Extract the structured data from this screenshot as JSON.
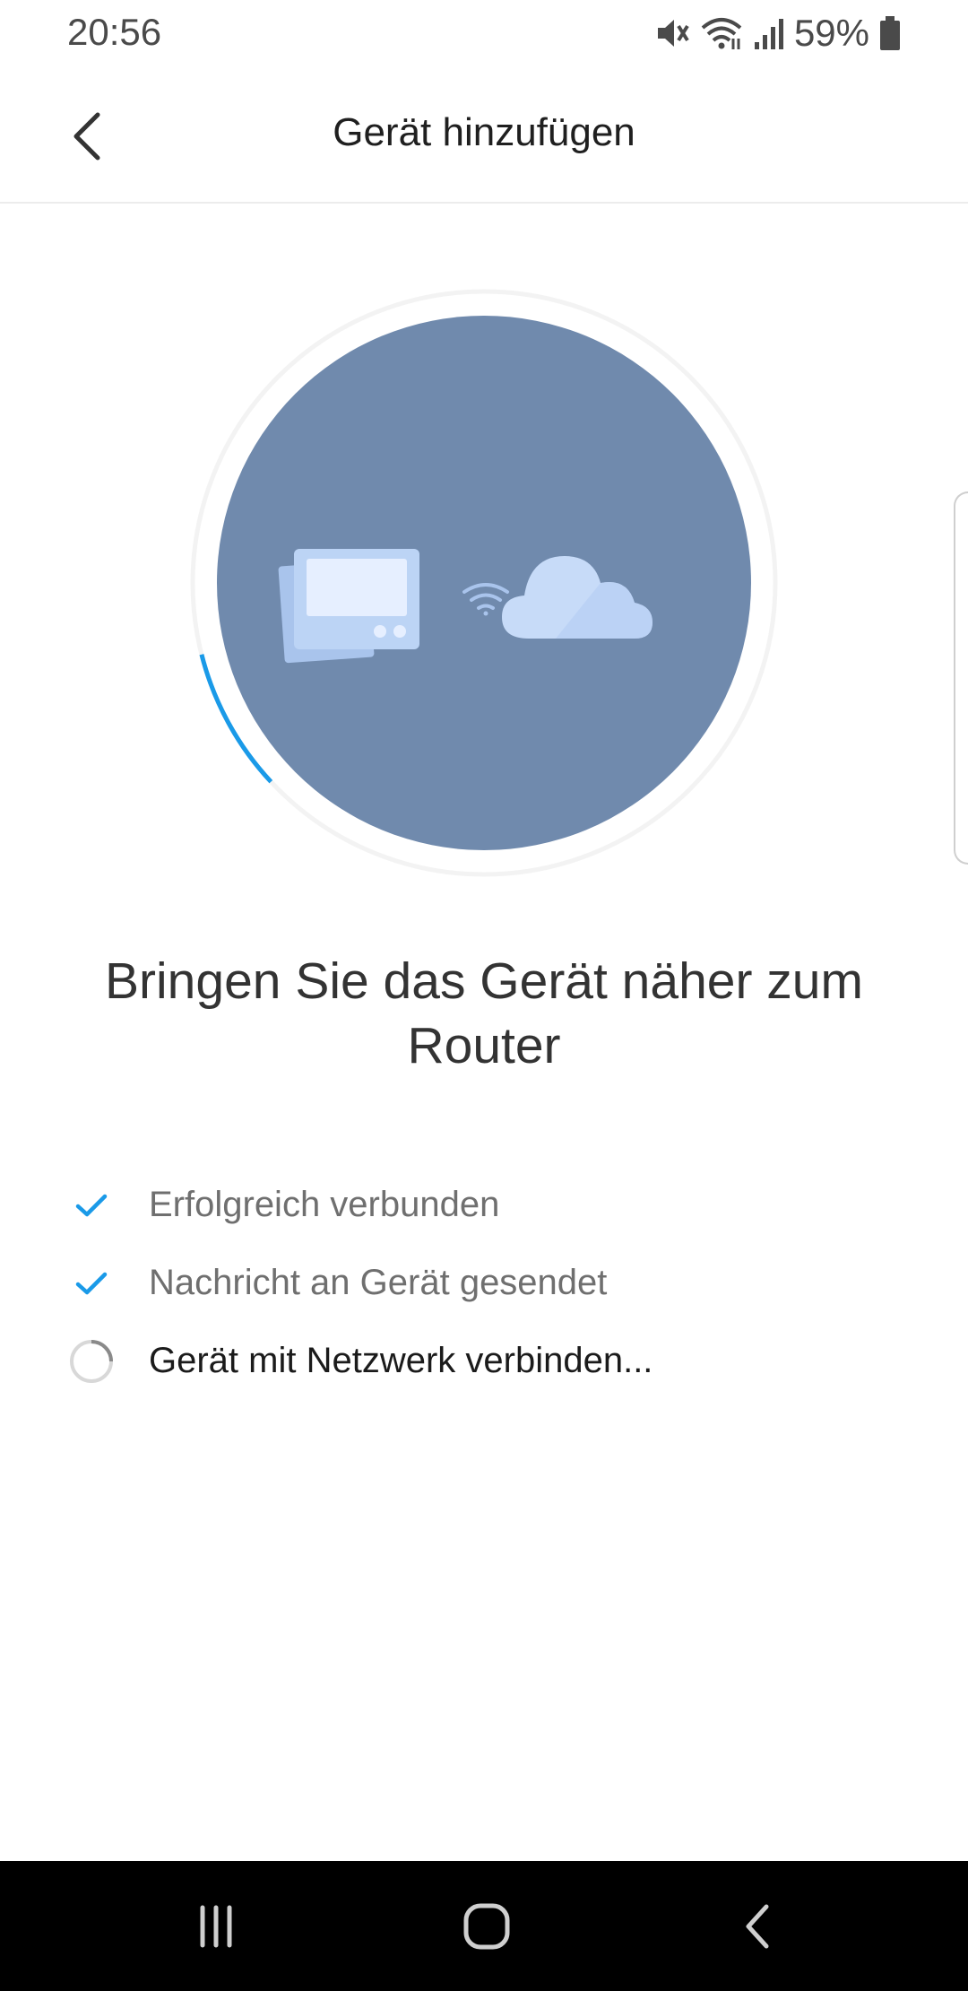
{
  "status_bar": {
    "time": "20:56",
    "battery_percent": "59%",
    "icons": [
      "mute-icon",
      "wifi-icon",
      "signal-icon",
      "battery-icon"
    ]
  },
  "app_bar": {
    "title": "Gerät hinzufügen",
    "back_icon": "chevron-left-icon"
  },
  "illustration": {
    "progress_fraction": 0.08,
    "accent_color": "#1a9ae8",
    "circle_color": "#708aad",
    "icons": [
      "device-icon",
      "wifi-icon",
      "cloud-icon"
    ]
  },
  "message": "Bringen Sie das Gerät näher zum Router",
  "steps": [
    {
      "label": "Erfolgreich verbunden",
      "state": "done"
    },
    {
      "label": "Nachricht an Gerät gesendet",
      "state": "done"
    },
    {
      "label": "Gerät mit Netzwerk verbinden...",
      "state": "in-progress"
    }
  ],
  "nav_bar": {
    "buttons": [
      "recent-apps",
      "home",
      "back"
    ]
  }
}
